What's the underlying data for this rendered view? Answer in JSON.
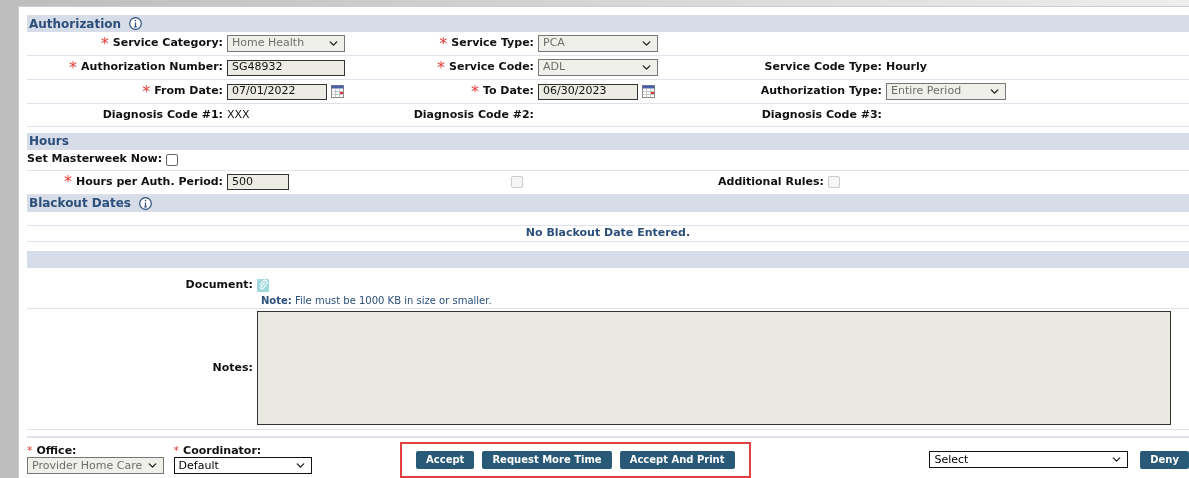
{
  "authorization": {
    "title": "Authorization",
    "rows": [
      [
        {
          "kind": "select",
          "label": "Service Category:",
          "required_mark": "*",
          "value": "Home Health",
          "disabled": true
        },
        {
          "kind": "select",
          "label": "Service Type:",
          "required_mark": "*",
          "value": "PCA",
          "disabled": true
        },
        {
          "kind": "blank"
        }
      ],
      [
        {
          "kind": "text",
          "label": "Authorization Number:",
          "required_mark": "*",
          "value": "SG48932"
        },
        {
          "kind": "select",
          "label": "Service Code:",
          "required_mark": "*",
          "value": "ADL",
          "disabled": true
        },
        {
          "kind": "value",
          "label": "Service Code Type:",
          "value": "Hourly",
          "bold": true
        }
      ],
      [
        {
          "kind": "date",
          "label": "From Date:",
          "required_mark": "*",
          "value": "07/01/2022"
        },
        {
          "kind": "date",
          "label": "To Date:",
          "required_mark": "*",
          "value": "06/30/2023"
        },
        {
          "kind": "select",
          "label": "Authorization Type:",
          "value": "Entire Period",
          "disabled": true
        }
      ],
      [
        {
          "kind": "value",
          "label": "Diagnosis Code #1:",
          "value": "XXX",
          "bold": false
        },
        {
          "kind": "value",
          "label": "Diagnosis Code #2:"
        },
        {
          "kind": "value",
          "label": "Diagnosis Code #3:"
        }
      ]
    ]
  },
  "hours": {
    "title": "Hours",
    "masterweek": {
      "label": "Set Masterweek Now:",
      "checked": false
    },
    "hours_per_period": {
      "label": "Hours per Auth. Period:",
      "required_mark": "*",
      "value": "500"
    },
    "middle_checkbox": {
      "checked": false,
      "disabled": true
    },
    "additional_rules": {
      "label": "Additional Rules:",
      "checked": false,
      "disabled": true
    }
  },
  "blackout": {
    "title": "Blackout Dates",
    "message": "No Blackout Date Entered."
  },
  "attachments": {
    "document_label": "Document:",
    "note_label": "Note:",
    "note_text": "File must be 1000 KB in size or smaller.",
    "notes_label": "Notes:"
  },
  "footer": {
    "office": {
      "label": "Office:",
      "required_mark": "*",
      "value": "Provider Home Care",
      "disabled": true
    },
    "coordinator": {
      "label": "Coordinator:",
      "required_mark": "*",
      "value": "Default",
      "disabled": false
    },
    "buttons": [
      "Accept",
      "Request More Time",
      "Accept And Print"
    ],
    "action_select": {
      "value": "Select",
      "disabled": false
    },
    "deny": "Deny"
  }
}
